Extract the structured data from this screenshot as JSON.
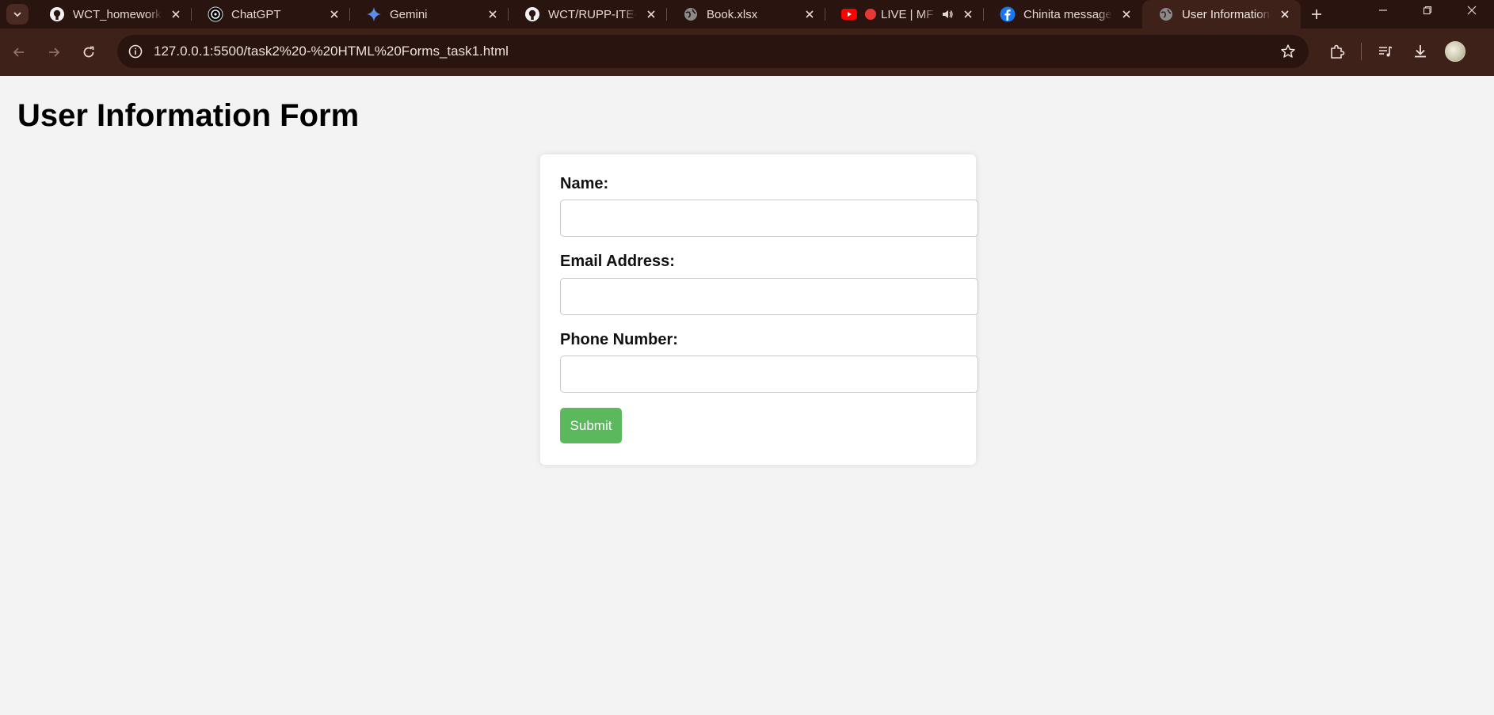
{
  "browser": {
    "tabs": [
      {
        "title": "WCT_homework",
        "icon": "github-icon",
        "active": false
      },
      {
        "title": "ChatGPT",
        "icon": "chatgpt-icon",
        "active": false
      },
      {
        "title": "Gemini",
        "icon": "gemini-icon",
        "active": false
      },
      {
        "title": "WCT/RUPP-ITE-2",
        "icon": "github-icon",
        "active": false
      },
      {
        "title": "Book.xlsx",
        "icon": "globe-icon",
        "active": false
      },
      {
        "title": "LIVE | MF",
        "icon": "youtube-icon",
        "active": false,
        "recording": true,
        "audio": true
      },
      {
        "title": "Chinita message",
        "icon": "facebook-icon",
        "active": false
      },
      {
        "title": "User Information",
        "icon": "globe-icon",
        "active": true
      }
    ],
    "url": "127.0.0.1:5500/task2%20-%20HTML%20Forms_task1.html",
    "colors": {
      "frame": "#2a1410",
      "toolbar": "#3e2119",
      "accent": "#5cb85c"
    }
  },
  "page": {
    "title": "User Information Form",
    "form": {
      "fields": [
        {
          "label": "Name:",
          "value": "",
          "placeholder": ""
        },
        {
          "label": "Email Address:",
          "value": "",
          "placeholder": ""
        },
        {
          "label": "Phone Number:",
          "value": "",
          "placeholder": ""
        }
      ],
      "submit_label": "Submit"
    }
  }
}
